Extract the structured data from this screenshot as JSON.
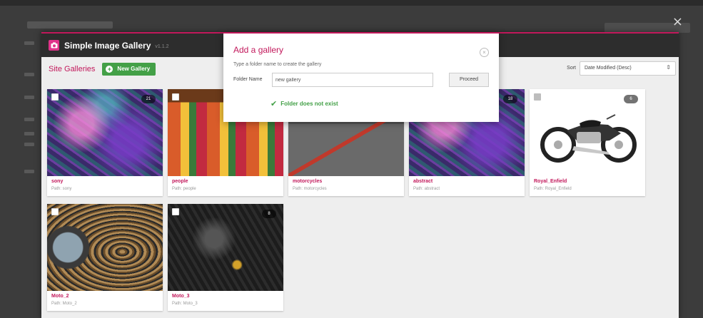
{
  "overlay": {
    "close_glyph": "×"
  },
  "app": {
    "title": "Simple Image Gallery",
    "version": "v1.1.2",
    "accent_color": "#c2185b",
    "success_color": "#43a047"
  },
  "toolbar": {
    "section_title": "Site Galleries",
    "new_gallery_label": "New Gallery",
    "sort_label": "Sort",
    "sort_value": "Date Modified (Desc)"
  },
  "galleries": [
    {
      "name": "sony",
      "path": "Path: sony",
      "count": "21",
      "thumb": "abstract"
    },
    {
      "name": "people",
      "path": "Path: people",
      "count": "",
      "thumb": "people"
    },
    {
      "name": "motorcycles",
      "path": "Path: motorcycles",
      "count": "",
      "thumb": "moto"
    },
    {
      "name": "abstract",
      "path": "Path: abstract",
      "count": "18",
      "thumb": "abstract"
    },
    {
      "name": "Royal_Enfield",
      "path": "Path: Royal_Enfield",
      "count": "6",
      "thumb": "enfield"
    },
    {
      "name": "Moto_2",
      "path": "Path: Moto_2",
      "count": "",
      "thumb": "moto2"
    },
    {
      "name": "Moto_3",
      "path": "Path: Moto_3",
      "count": "8",
      "thumb": "moto3"
    }
  ],
  "modal": {
    "title": "Add a gallery",
    "hint": "Type a folder name to create the gallery",
    "folder_label": "Folder Name",
    "folder_value": "new gallery",
    "proceed_label": "Proceed",
    "status_text": "Folder does not exist",
    "close_glyph": "×"
  }
}
